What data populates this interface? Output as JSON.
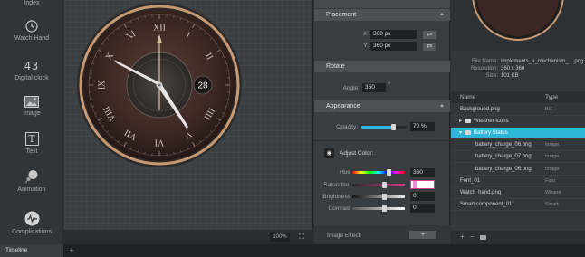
{
  "toolbar": {
    "items": [
      {
        "label": "Index",
        "icon": "index-icon"
      },
      {
        "label": "Watch Hand",
        "icon": "clock-icon"
      },
      {
        "label": "Digital clock",
        "icon": "digital-clock-icon",
        "glyph": "43"
      },
      {
        "label": "Image",
        "icon": "image-icon"
      },
      {
        "label": "Text",
        "icon": "text-icon",
        "glyph": "T"
      },
      {
        "label": "Animation",
        "icon": "animation-icon"
      },
      {
        "label": "Complications",
        "icon": "complications-icon"
      }
    ]
  },
  "canvas": {
    "zoom": "100%",
    "watch": {
      "date": "28",
      "numerals": [
        "XII",
        "I",
        "II",
        "III",
        "IIII",
        "V",
        "VI",
        "VII",
        "VIII",
        "IX",
        "X",
        "XI"
      ],
      "colors": {
        "bezel": "#c99a72",
        "dial": "#3a2622",
        "hands": "#e6e6e6",
        "second_hand": "#d9c7a6"
      }
    }
  },
  "properties": {
    "placement": {
      "title": "Placement",
      "x_label": "X:",
      "x_value": "360 px",
      "x_unit": "px",
      "y_label": "Y:",
      "y_value": "360 px",
      "y_unit": "px"
    },
    "rotate": {
      "title": "Rotate",
      "angle_label": "Angle:",
      "angle_value": "360",
      "angle_unit": "°"
    },
    "appearance": {
      "title": "Appearance",
      "opacity_label": "Opacity:",
      "opacity_value": "70 %",
      "opacity_level": 0.7
    },
    "adjust_color": {
      "title": "Adjust Color:",
      "hue_label": "Hue",
      "hue_value": "360",
      "saturation_label": "Saturation",
      "saturation_value": "",
      "brightness_label": "Brightness",
      "brightness_value": "0",
      "contrast_label": "Contrast",
      "contrast_value": "0"
    },
    "image_effect": {
      "label": "Image Effect:",
      "button": "+"
    }
  },
  "right_panel": {
    "file_name_key": "File Name:",
    "file_name_value": "implements_a_mechanism_... png",
    "resolution_key": "Resolution:",
    "resolution_value": "360 x 360",
    "size_key": "Size:",
    "size_value": "101 KB",
    "columns": {
      "name": "Name",
      "type": "Type"
    },
    "rows": [
      {
        "name": "Background.png",
        "type": "BG",
        "indent": 0,
        "folder": false,
        "arrow": "",
        "selected": false
      },
      {
        "name": "Weather Icons",
        "type": "",
        "indent": 1,
        "folder": true,
        "arrow": "▸",
        "selected": false
      },
      {
        "name": "Battery Status",
        "type": "",
        "indent": 1,
        "folder": true,
        "arrow": "▾",
        "selected": true
      },
      {
        "name": "battery_charge_06.png",
        "type": "Image",
        "indent": 2,
        "folder": false,
        "arrow": "",
        "selected": false
      },
      {
        "name": "battery_charge_07.png",
        "type": "Image",
        "indent": 2,
        "folder": false,
        "arrow": "",
        "selected": false
      },
      {
        "name": "battery_charge_06.png",
        "type": "Image",
        "indent": 2,
        "folder": false,
        "arrow": "",
        "selected": false
      },
      {
        "name": "Font_01",
        "type": "Font",
        "indent": 0,
        "folder": false,
        "arrow": "",
        "selected": false
      },
      {
        "name": "Watch_hand.png",
        "type": "Whand",
        "indent": 0,
        "folder": false,
        "arrow": "",
        "selected": false
      },
      {
        "name": "Smart component_01",
        "type": "Smart",
        "indent": 0,
        "folder": false,
        "arrow": "",
        "selected": false
      }
    ],
    "footer_buttons": [
      "+",
      "−"
    ]
  },
  "tabs": {
    "timeline": "Timeline",
    "add": "+"
  },
  "colors": {
    "accent": "#2cb6d8",
    "panel": "#3a3d40",
    "header": "#4d5155"
  }
}
